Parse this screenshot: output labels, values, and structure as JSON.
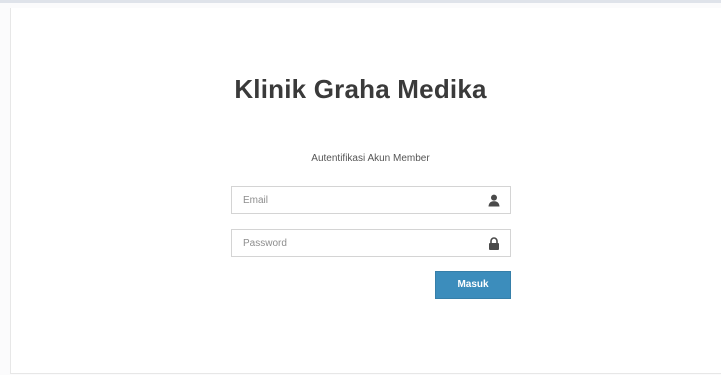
{
  "login": {
    "title": "Klinik Graha Medika",
    "subtitle": "Autentifikasi Akun Member",
    "email": {
      "placeholder": "Email",
      "value": "",
      "icon": "user-icon"
    },
    "password": {
      "placeholder": "Password",
      "value": "",
      "icon": "lock-icon"
    },
    "submit_label": "Masuk",
    "accent_color": "#3c8dbc"
  }
}
